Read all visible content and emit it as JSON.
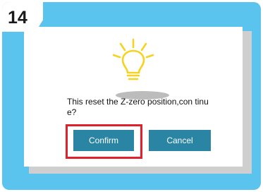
{
  "step": {
    "number": "14"
  },
  "dialog": {
    "message": "This reset the Z-zero position,con tinue?",
    "confirm_label": "Confirm",
    "cancel_label": "Cancel"
  },
  "icons": {
    "hint": "lightbulb-icon"
  },
  "colors": {
    "frame": "#5bc4ee",
    "button": "#2a84a4",
    "highlight": "#e0202a",
    "bulb": "#f5d320"
  }
}
